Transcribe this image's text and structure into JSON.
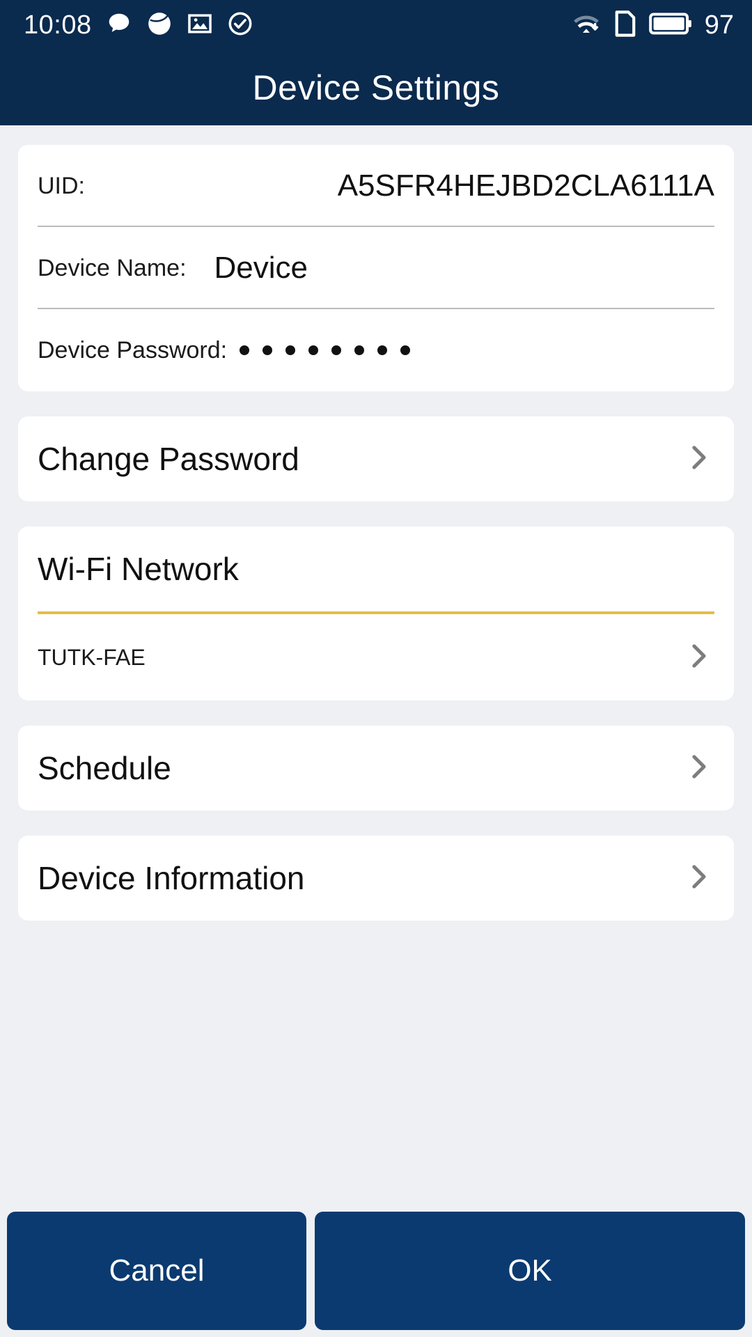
{
  "statusbar": {
    "time": "10:08",
    "battery_percent": "97",
    "left_icons": [
      {
        "name": "message-bubble-icon"
      },
      {
        "name": "health-plus-circle-icon"
      },
      {
        "name": "image-photo-icon"
      },
      {
        "name": "check-circle-icon"
      }
    ],
    "right_icons": [
      {
        "name": "wifi-download-icon"
      },
      {
        "name": "sim-card-icon"
      },
      {
        "name": "battery-icon"
      }
    ],
    "background_color": "#0a2a4e",
    "foreground_color": "#ffffff"
  },
  "header": {
    "title": "Device Settings",
    "background_color": "#0a2a4e"
  },
  "device_info": {
    "uid_label": "UID:",
    "uid_value": "A5SFR4HEJBD2CLA6111A",
    "name_label": "Device Name:",
    "name_value": "Device",
    "password_label": "Device Password:",
    "password_masked_count": 8
  },
  "rows": {
    "change_password": "Change Password",
    "schedule": "Schedule",
    "device_information": "Device Information"
  },
  "wifi": {
    "section_title": "Wi-Fi Network",
    "divider_color": "#e5be45",
    "ssid": "TUTK-FAE"
  },
  "footer": {
    "cancel_label": "Cancel",
    "ok_label": "OK",
    "button_color": "#0a3a70"
  },
  "icons": {
    "chevron": "chevron-right-icon"
  }
}
